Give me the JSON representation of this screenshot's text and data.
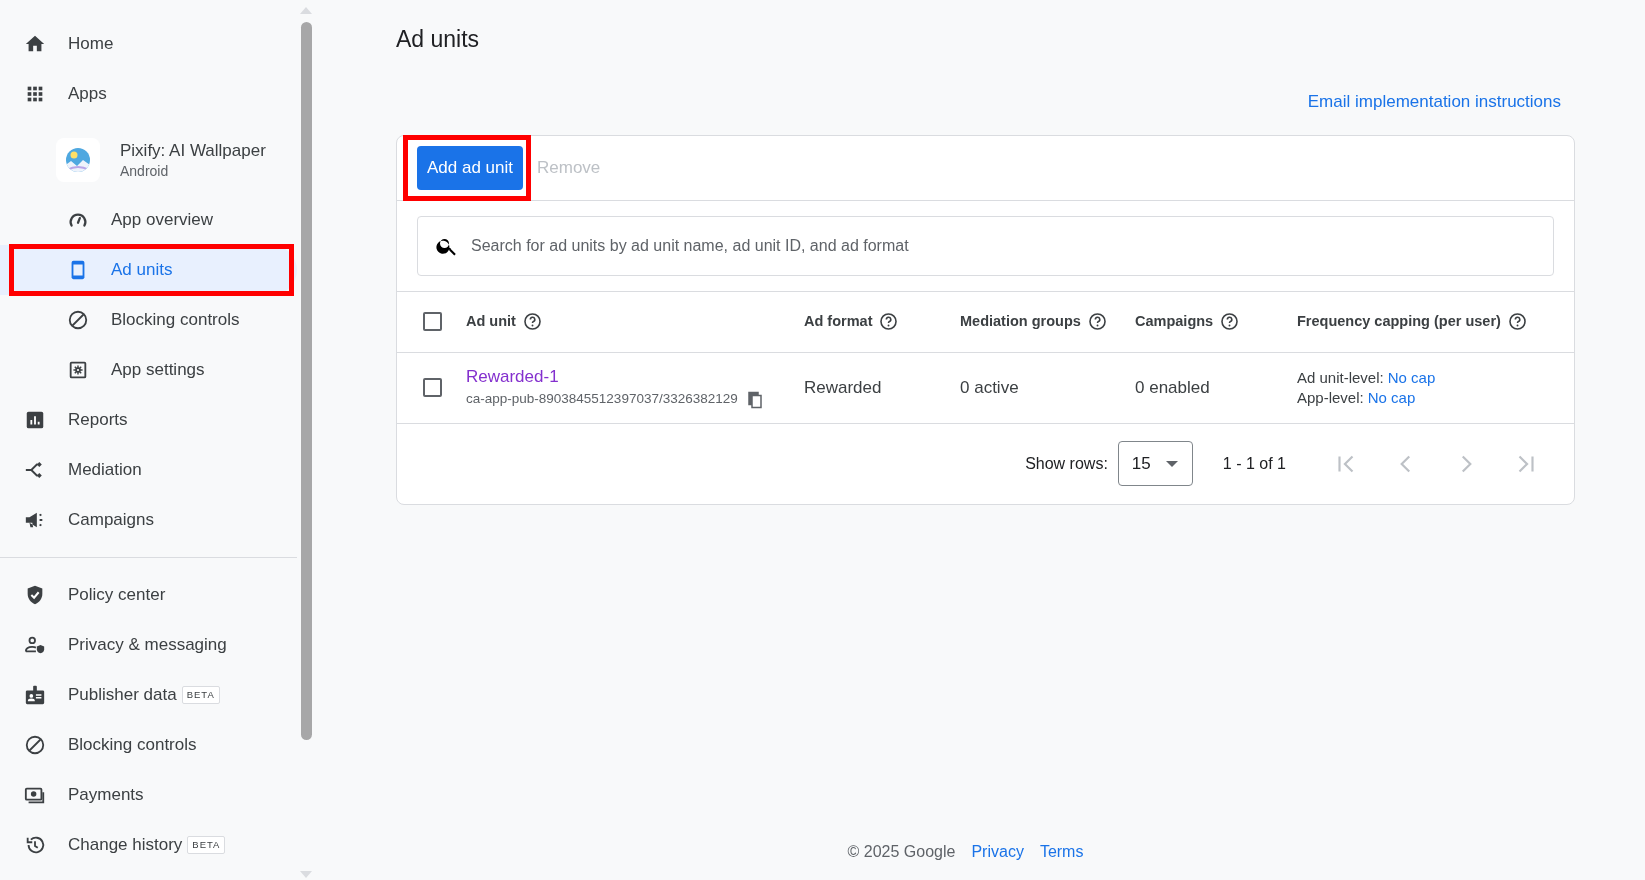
{
  "nav": [
    {
      "label": "Home",
      "selected": false,
      "highlighted": false
    },
    {
      "label": "Apps",
      "selected": false,
      "highlighted": false,
      "children": [
        {
          "kind": "app",
          "label": "Pixify: AI Wallpaper",
          "platform": "Android",
          "selected": false,
          "highlighted": false,
          "children": [
            {
              "label": "App overview",
              "selected": false,
              "highlighted": false
            },
            {
              "label": "Ad units",
              "selected": true,
              "highlighted": true
            },
            {
              "label": "Blocking controls",
              "selected": false,
              "highlighted": false
            },
            {
              "label": "App settings",
              "selected": false,
              "highlighted": false
            }
          ]
        }
      ]
    },
    {
      "label": "Reports",
      "selected": false,
      "highlighted": false
    },
    {
      "label": "Mediation",
      "selected": false,
      "highlighted": false
    },
    {
      "label": "Campaigns",
      "selected": false,
      "highlighted": false
    }
  ],
  "nav_secondary": [
    {
      "label": "Policy center",
      "selected": false,
      "highlighted": false
    },
    {
      "label": "Privacy & messaging",
      "selected": false,
      "highlighted": false
    },
    {
      "label": "Publisher data",
      "badge": "BETA",
      "selected": false,
      "highlighted": false
    },
    {
      "label": "Blocking controls",
      "selected": false,
      "highlighted": false
    },
    {
      "label": "Payments",
      "selected": false,
      "highlighted": false
    },
    {
      "label": "Change history",
      "badge": "BETA",
      "selected": false,
      "highlighted": false
    }
  ],
  "page_title": "Ad units",
  "email_link": "Email implementation instructions",
  "toolbar": {
    "add_button": {
      "label": "Add ad unit",
      "highlighted": true
    },
    "remove_button": {
      "label": "Remove",
      "disabled": true
    }
  },
  "search": {
    "placeholder": "Search for ad units by ad unit name, ad unit ID, and ad format"
  },
  "table": {
    "select_all_checked": false,
    "columns": [
      {
        "label": "Ad unit"
      },
      {
        "label": "Ad format"
      },
      {
        "label": "Mediation groups"
      },
      {
        "label": "Campaigns"
      },
      {
        "label": "Frequency capping (per user)"
      }
    ],
    "rows": [
      {
        "checked": false,
        "name": "Rewarded-1",
        "id": "ca-app-pub-8903845512397037/3326382129",
        "format": "Rewarded",
        "mediation": "0 active",
        "campaigns": "0 enabled",
        "capping": [
          {
            "label": "Ad unit-level:",
            "value": "No cap"
          },
          {
            "label": "App-level:",
            "value": "No cap"
          }
        ]
      }
    ]
  },
  "pagination": {
    "show_rows_label": "Show rows:",
    "rows_value": "15",
    "range": "1 - 1 of 1",
    "first_disabled": true,
    "prev_disabled": true,
    "next_disabled": true,
    "last_disabled": true
  },
  "footer": {
    "copyright": "© 2025 Google",
    "links": [
      "Privacy",
      "Terms"
    ]
  }
}
